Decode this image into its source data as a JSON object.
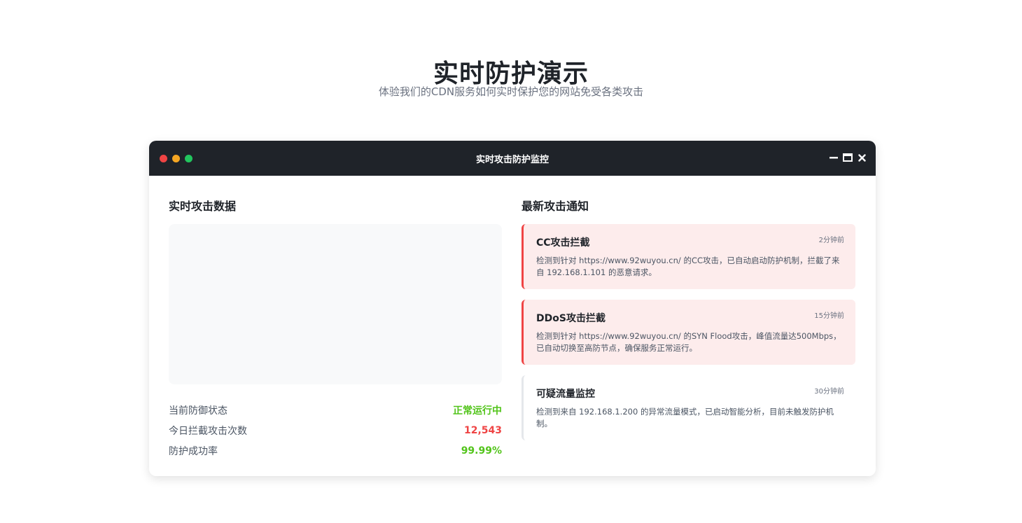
{
  "header": {
    "title": "实时防护演示",
    "subtitle": "体验我们的CDN服务如何实时保护您的网站免受各类攻击"
  },
  "window": {
    "title": "实时攻击防护监控",
    "dot_colors": [
      "#ef4444",
      "#f5a623",
      "#22c55e"
    ],
    "controls": [
      "minimize-icon",
      "maximize-icon",
      "close-icon"
    ]
  },
  "left": {
    "title": "实时攻击数据",
    "stats": [
      {
        "label": "当前防御状态",
        "value": "正常运行中",
        "color": "#52c41a"
      },
      {
        "label": "今日拦截攻击次数",
        "value": "12,543",
        "color": "#ef4444"
      },
      {
        "label": "防护成功率",
        "value": "99.99%",
        "color": "#52c41a"
      }
    ]
  },
  "right": {
    "title": "最新攻击通知",
    "notices": [
      {
        "title": "CC攻击拦截",
        "time": "2分钟前",
        "desc": "检测到针对 https://www.92wuyou.cn/ 的CC攻击，已自动启动防护机制，拦截了来自 192.168.1.101 的恶意请求。",
        "level": "alert"
      },
      {
        "title": "DDoS攻击拦截",
        "time": "15分钟前",
        "desc": "检测到针对 https://www.92wuyou.cn/ 的SYN Flood攻击，峰值流量达500Mbps，已自动切换至高防节点，确保服务正常运行。",
        "level": "alert"
      },
      {
        "title": "可疑流量监控",
        "time": "30分钟前",
        "desc": "检测到来自 192.168.1.200 的异常流量模式，已启动智能分析，目前未触发防护机制。",
        "level": "info"
      }
    ]
  }
}
